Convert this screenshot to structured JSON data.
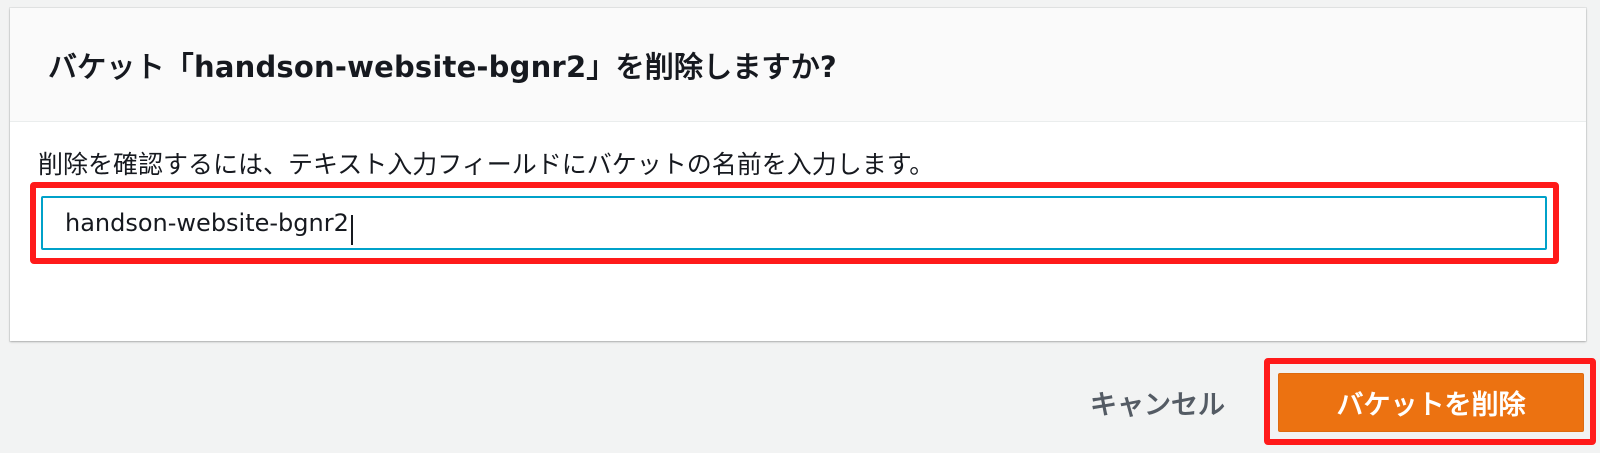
{
  "dialog": {
    "title": "バケット「handson-website-bgnr2」を削除しますか?",
    "instruction": "削除を確認するには、テキスト入力フィールドにバケットの名前を入力します。",
    "confirm_input": {
      "value": "handson-website-bgnr2"
    }
  },
  "footer": {
    "cancel_label": "キャンセル",
    "delete_label": "バケットを削除"
  },
  "colors": {
    "primary_button": "#ec7211",
    "focus_border": "#00a1c9",
    "highlight_annotation": "#ff1a1a"
  }
}
